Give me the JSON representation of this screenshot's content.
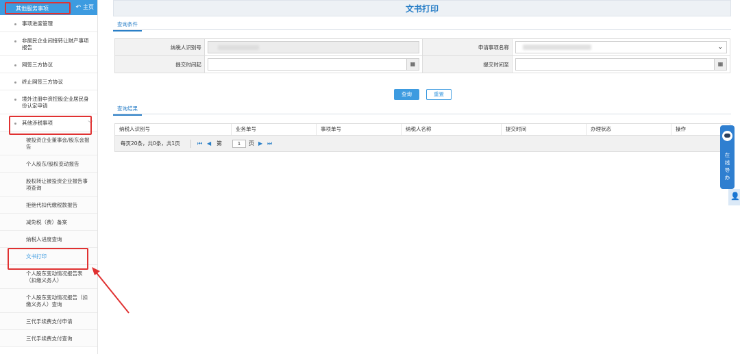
{
  "colors": {
    "accent": "#3d9be0",
    "title": "#2a7fc7",
    "annotation": "#e03131"
  },
  "sidebar": {
    "title": "其他服务事项",
    "home_label": "主页",
    "items": [
      {
        "label": "事项进度管理"
      },
      {
        "label": "非居民企业间接转让财产事项报告"
      },
      {
        "label": "网签三方协议"
      },
      {
        "label": "终止网签三方协议"
      },
      {
        "label": "境外注册中资控股企业居民身份认定申请"
      },
      {
        "label": "其他涉税事项"
      }
    ],
    "sub_items": [
      {
        "label": "被投资企业董事会/股东会报告"
      },
      {
        "label": "个人股东/股权变动报告"
      },
      {
        "label": "股权转让被投资企业报告事项查询"
      },
      {
        "label": "拒绝代扣代缴税款报告"
      },
      {
        "label": "减免税（费）备案"
      },
      {
        "label": "纳税人进度查询"
      },
      {
        "label": "文书打印"
      },
      {
        "label": "个人股东变动情况报告表（扣缴义务人）"
      },
      {
        "label": "个人股东变动情况报告（扣缴义务人）查询"
      },
      {
        "label": "三代手续费支付申请"
      },
      {
        "label": "三代手续费支付查询"
      }
    ]
  },
  "main": {
    "title": "文书打印",
    "query_tab": "查询条件",
    "result_tab": "查询结果",
    "form": {
      "taxpayer_id_label": "纳税人识别号",
      "matter_name_label": "申请事项名称",
      "submit_from_label": "提交时间起",
      "submit_to_label": "提交时间至"
    },
    "buttons": {
      "query": "查询",
      "reset": "重置"
    },
    "grid": {
      "columns": [
        "纳税人识别号",
        "业务单号",
        "事项单号",
        "纳税人名称",
        "提交时间",
        "办理状态",
        "操作"
      ],
      "pager_info": "每页20条，共0条，共1页",
      "page_prefix": "第",
      "page_value": "1",
      "page_suffix": "页"
    }
  },
  "float_help": {
    "label": "在线导办"
  }
}
